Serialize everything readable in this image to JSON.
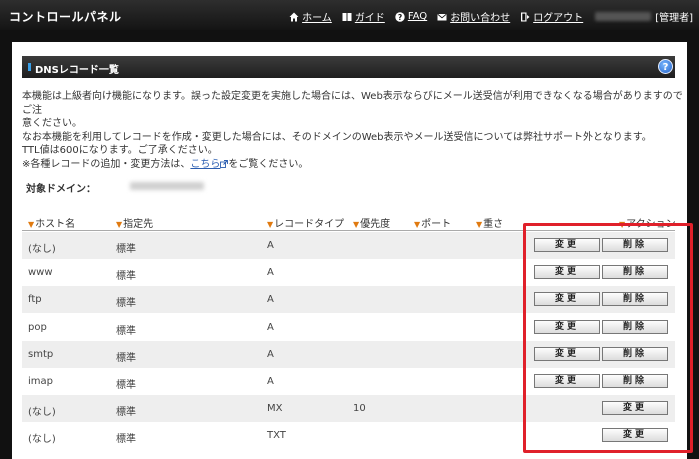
{
  "header": {
    "title": "コントロールパネル",
    "nav": [
      {
        "icon": "home-icon",
        "label": "ホーム"
      },
      {
        "icon": "book-icon",
        "label": "ガイド"
      },
      {
        "icon": "question-icon",
        "label": "FAQ"
      },
      {
        "icon": "mail-icon",
        "label": "お問い合わせ"
      },
      {
        "icon": "logout-icon",
        "label": "ログアウト"
      }
    ],
    "role": "[管理者]"
  },
  "panel": {
    "title": "DNSレコード一覧",
    "help": "?"
  },
  "notice": {
    "line1": "本機能は上級者向け機能になります。誤った設定変更を実施した場合には、Web表示ならびにメール送受信が利用できなくなる場合がありますのでご注",
    "line2": "意ください。",
    "line3": "なお本機能を利用してレコードを作成・変更した場合には、そのドメインのWeb表示やメール送受信については弊社サポート外となります。",
    "line4": "TTL値は600になります。ご了承ください。",
    "line5_pre": "※各種レコードの追加・変更方法は、",
    "line5_link": "こちら",
    "line5_post": "をご覧ください。"
  },
  "domain_label": "対象ドメイン：",
  "columns": {
    "host": "ホスト名",
    "target": "指定先",
    "type": "レコードタイプ",
    "priority": "優先度",
    "port": "ポート",
    "weight": "重さ",
    "action": "アクション"
  },
  "buttons": {
    "edit": "変更",
    "delete": "削除"
  },
  "rows": [
    {
      "host": "(なし)",
      "target": "標準",
      "type": "A",
      "priority": "",
      "deletable": true
    },
    {
      "host": "www",
      "target": "標準",
      "type": "A",
      "priority": "",
      "deletable": true
    },
    {
      "host": "ftp",
      "target": "標準",
      "type": "A",
      "priority": "",
      "deletable": true
    },
    {
      "host": "pop",
      "target": "標準",
      "type": "A",
      "priority": "",
      "deletable": true
    },
    {
      "host": "smtp",
      "target": "標準",
      "type": "A",
      "priority": "",
      "deletable": true
    },
    {
      "host": "imap",
      "target": "標準",
      "type": "A",
      "priority": "",
      "deletable": true
    },
    {
      "host": "(なし)",
      "target": "標準",
      "type": "MX",
      "priority": "10",
      "deletable": false
    },
    {
      "host": "(なし)",
      "target": "標準",
      "type": "TXT",
      "priority": "",
      "deletable": false
    }
  ]
}
